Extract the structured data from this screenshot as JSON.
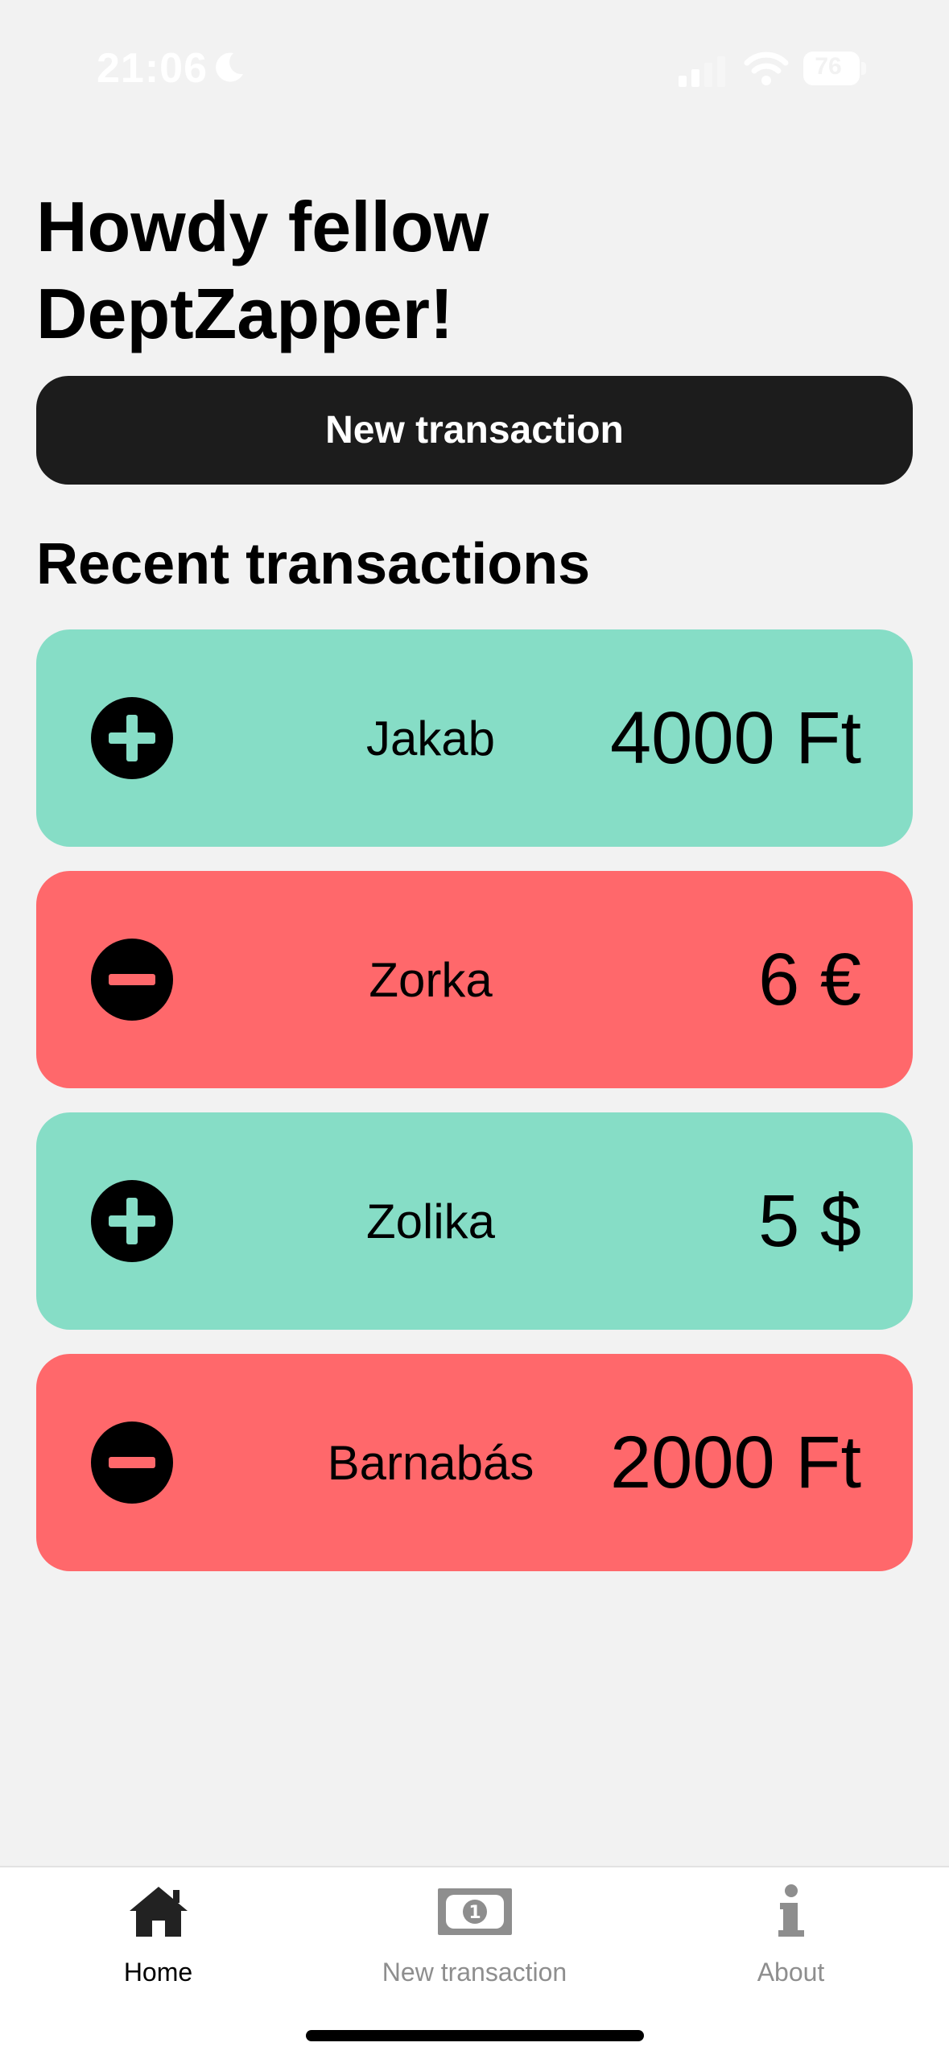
{
  "status_bar": {
    "time": "21:06",
    "battery": "76"
  },
  "greeting": "Howdy fellow DeptZapper!",
  "new_transaction_button": "New transaction",
  "recent_title": "Recent transactions",
  "transactions": [
    {
      "type": "credit",
      "icon": "plus-circle-icon",
      "name": "Jakab",
      "amount": "4000 Ft"
    },
    {
      "type": "debit",
      "icon": "minus-circle-icon",
      "name": "Zorka",
      "amount": "6 €"
    },
    {
      "type": "credit",
      "icon": "plus-circle-icon",
      "name": "Zolika",
      "amount": "5 $"
    },
    {
      "type": "debit",
      "icon": "minus-circle-icon",
      "name": "Barnabás",
      "amount": "2000 Ft"
    }
  ],
  "colors": {
    "credit": "#86ddc6",
    "debit": "#ff686b",
    "button": "#1c1c1c",
    "background": "#f2f2f2"
  },
  "tabs": [
    {
      "label": "Home",
      "icon": "home-icon",
      "active": true
    },
    {
      "label": "New transaction",
      "icon": "banknote-icon",
      "active": false
    },
    {
      "label": "About",
      "icon": "info-icon",
      "active": false
    }
  ]
}
